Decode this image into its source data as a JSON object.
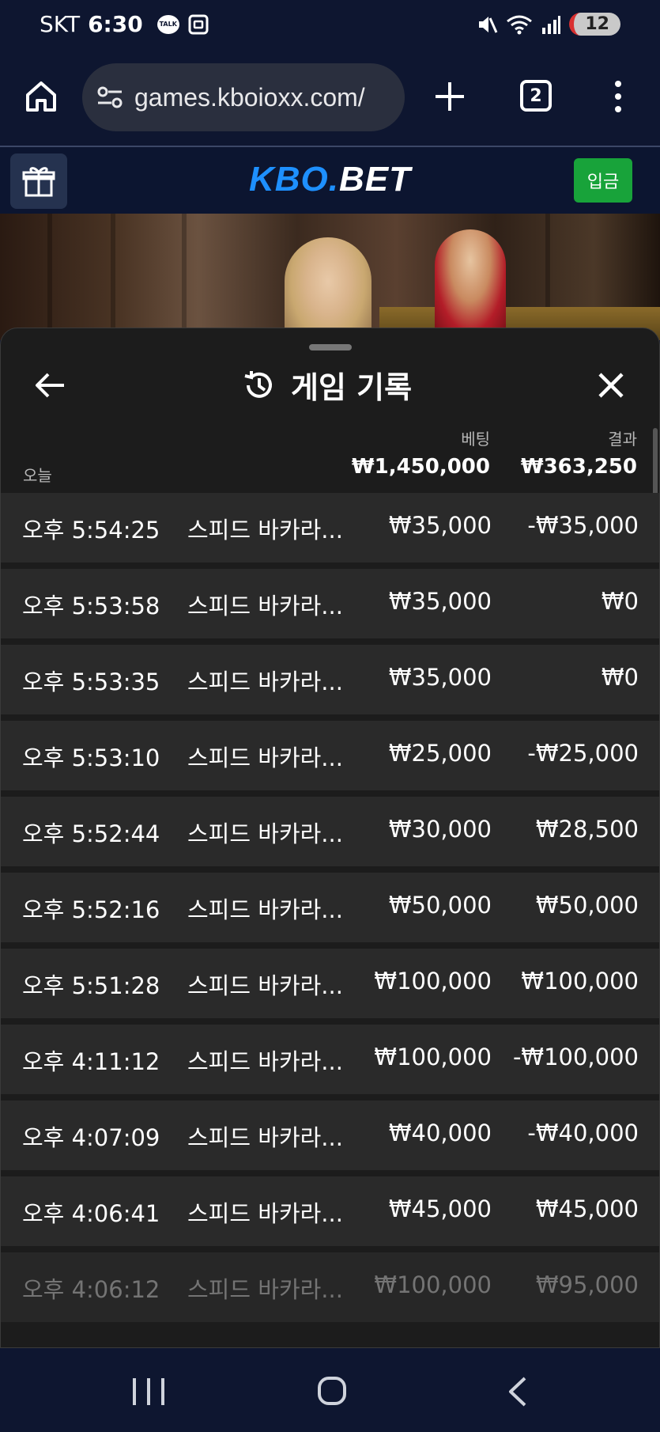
{
  "status_bar": {
    "carrier": "SKT",
    "time": "6:30",
    "talk_label": "TALK",
    "notification_count": "12"
  },
  "browser": {
    "url": "games.kboioxx.com/",
    "tab_count": "2"
  },
  "site_header": {
    "logo_part1": "KBO.",
    "logo_part2": "BET",
    "deposit_label": "입금"
  },
  "sheet": {
    "title": "게임 기록",
    "day_label": "오늘",
    "bet_header": "베팅",
    "result_header": "결과",
    "bet_total": "₩1,450,000",
    "result_total": "₩363,250"
  },
  "records": [
    {
      "time": "오후 5:54:25",
      "game": "스피드 바카라...",
      "bet": "₩35,000",
      "result": "-₩35,000"
    },
    {
      "time": "오후 5:53:58",
      "game": "스피드 바카라...",
      "bet": "₩35,000",
      "result": "₩0"
    },
    {
      "time": "오후 5:53:35",
      "game": "스피드 바카라...",
      "bet": "₩35,000",
      "result": "₩0"
    },
    {
      "time": "오후 5:53:10",
      "game": "스피드 바카라...",
      "bet": "₩25,000",
      "result": "-₩25,000"
    },
    {
      "time": "오후 5:52:44",
      "game": "스피드 바카라...",
      "bet": "₩30,000",
      "result": "₩28,500"
    },
    {
      "time": "오후 5:52:16",
      "game": "스피드 바카라...",
      "bet": "₩50,000",
      "result": "₩50,000"
    },
    {
      "time": "오후 5:51:28",
      "game": "스피드 바카라...",
      "bet": "₩100,000",
      "result": "₩100,000"
    },
    {
      "time": "오후 4:11:12",
      "game": "스피드 바카라...",
      "bet": "₩100,000",
      "result": "-₩100,000"
    },
    {
      "time": "오후 4:07:09",
      "game": "스피드 바카라...",
      "bet": "₩40,000",
      "result": "-₩40,000"
    },
    {
      "time": "오후 4:06:41",
      "game": "스피드 바카라...",
      "bet": "₩45,000",
      "result": "₩45,000"
    },
    {
      "time": "오후 4:06:12",
      "game": "스피드 바카라...",
      "bet": "₩100,000",
      "result": "₩95,000"
    }
  ],
  "colors": {
    "brand_blue": "#1e90ff",
    "deposit_green": "#18a33a",
    "sheet_bg": "#1c1c1c",
    "row_bg": "#2a2a2a",
    "header_bg": "#0c1530"
  },
  "icons": [
    "home-icon",
    "site-settings-icon",
    "plus-icon",
    "tabs-icon",
    "more-vert-icon",
    "gift-icon",
    "back-arrow-icon",
    "history-icon",
    "close-icon",
    "recent-apps-icon",
    "home-nav-icon",
    "back-nav-icon"
  ]
}
